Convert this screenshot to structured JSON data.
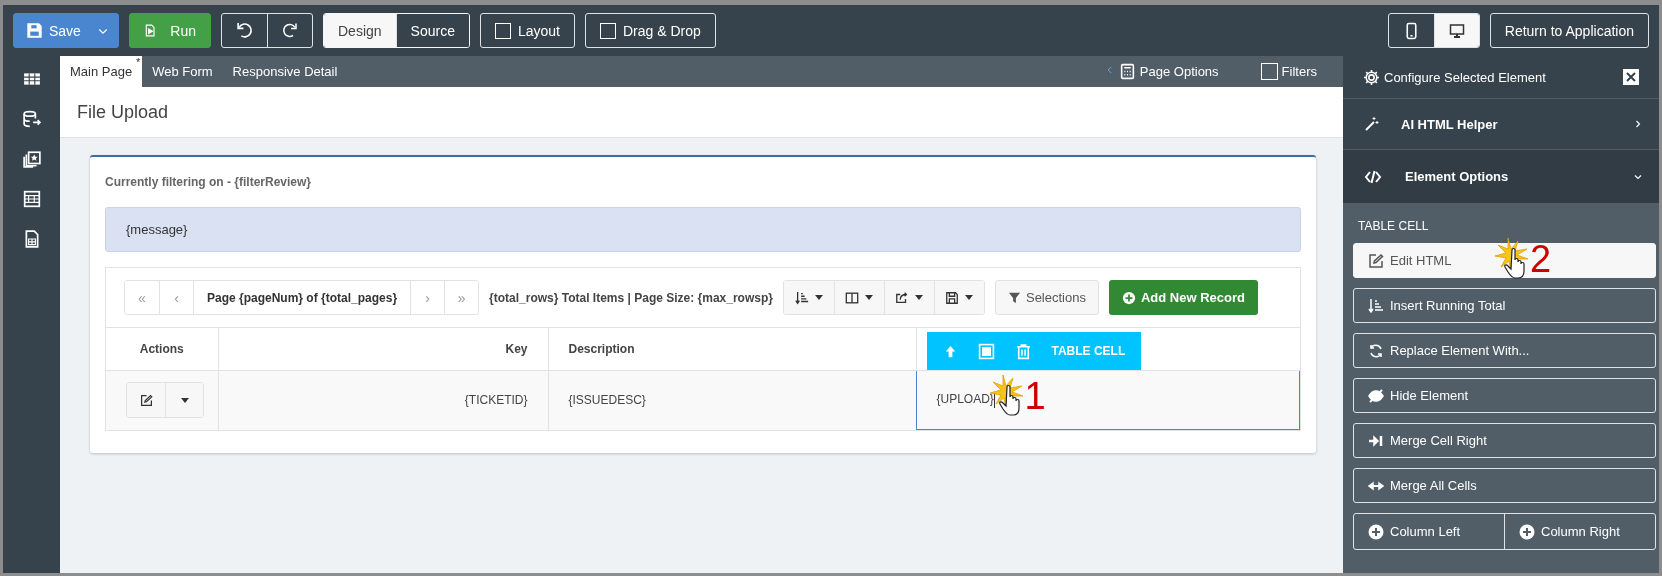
{
  "toolbar": {
    "save": {
      "label": "Save"
    },
    "run": {
      "label": "Run"
    },
    "views": [
      {
        "label": "Design",
        "selected": true
      },
      {
        "label": "Source",
        "selected": false
      }
    ],
    "toggles": [
      {
        "label": "Layout",
        "checked": false
      },
      {
        "label": "Drag & Drop",
        "checked": false
      }
    ],
    "devices": [
      {
        "kind": "mobile",
        "selected": false
      },
      {
        "kind": "desktop",
        "selected": true
      }
    ],
    "return_button": {
      "label": "Return to Application"
    }
  },
  "tabs": [
    {
      "label": "Main Page",
      "selected": true,
      "badge": "*"
    },
    {
      "label": "Web Form",
      "selected": false
    },
    {
      "label": "Responsive Detail",
      "selected": false
    }
  ],
  "tab_bar_right": {
    "page_options": "Page Options",
    "filters": {
      "label": "Filters",
      "checked": false
    }
  },
  "page": {
    "title": "File Upload",
    "filter_text": "Currently filtering on - {filterReview}",
    "message": "{message}",
    "pager": {
      "first": "«",
      "prev": "‹",
      "label": "Page {pageNum} of {total_pages}",
      "next": "›",
      "last": "»"
    },
    "summary": "{total_rows} Total Items | Page Size: {max_rowsp}",
    "tool_buttons": [
      {
        "kind": "sort"
      },
      {
        "kind": "columns"
      },
      {
        "kind": "export"
      },
      {
        "kind": "save"
      }
    ],
    "selections": "Selections",
    "add_button": "Add New Record",
    "table": {
      "columns": [
        {
          "label": "Actions"
        },
        {
          "label": "Key"
        },
        {
          "label": "Description"
        }
      ],
      "cell_toolbar": {
        "label": "TABLE CELL"
      },
      "rows": [
        {
          "cells": [
            {
              "text": "",
              "selected": false
            },
            {
              "text": "{TICKETID}",
              "selected": false
            },
            {
              "text": "{ISSUEDESC}",
              "selected": false
            },
            {
              "text": "{UPLOAD}",
              "selected": true
            }
          ]
        }
      ]
    }
  },
  "annotations": [
    {
      "label": "1"
    },
    {
      "label": "2"
    }
  ],
  "panel": {
    "title": "Configure Selected Element",
    "sections": [
      {
        "kind": "magic",
        "label": "AI HTML Helper",
        "expanded": false
      },
      {
        "kind": "code",
        "label": "Element Options",
        "expanded": true
      }
    ],
    "heading": "TABLE CELL",
    "actions": [
      {
        "kind": "edit",
        "label": "Edit HTML",
        "highlighted": true
      },
      {
        "kind": "running-total",
        "label": "Insert Running Total",
        "highlighted": false
      },
      {
        "kind": "replace",
        "label": "Replace Element With...",
        "highlighted": false
      },
      {
        "kind": "hide",
        "label": "Hide Element",
        "highlighted": false
      },
      {
        "kind": "merge-right",
        "label": "Merge Cell Right",
        "highlighted": false
      },
      {
        "kind": "merge-all",
        "label": "Merge All Cells",
        "highlighted": false
      }
    ],
    "column_buttons": [
      {
        "label": "Column Left"
      },
      {
        "label": "Column Right"
      }
    ]
  }
}
